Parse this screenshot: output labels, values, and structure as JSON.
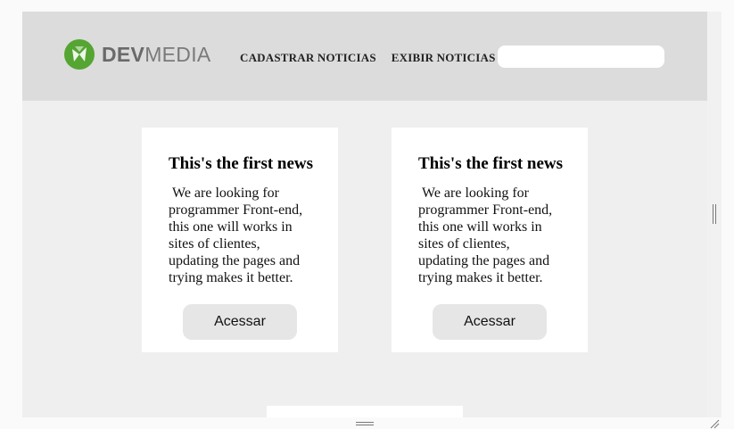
{
  "header": {
    "logo_bold": "DEV",
    "logo_light": "MEDIA",
    "logo_mark_color": "#55a532",
    "nav": [
      {
        "label": "CADASTRAR NOTICIAS"
      },
      {
        "label": "EXIBIR NOTICIAS"
      }
    ],
    "search": {
      "value": "",
      "placeholder": ""
    }
  },
  "news": [
    {
      "title": "This's the first news",
      "text": " We are looking for programmer Front-end, this one will works in sites of clientes, updating the pages and trying makes it better.",
      "button_label": "Acessar"
    },
    {
      "title": "This's the first news",
      "text": " We are looking for programmer Front-end, this one will works in sites of clientes, updating the pages and trying makes it better.",
      "button_label": "Acessar"
    }
  ],
  "colors": {
    "header_bg": "#dcdcdc",
    "page_bg": "#efefef",
    "card_bg": "#ffffff",
    "button_bg": "#e6e6e6"
  }
}
